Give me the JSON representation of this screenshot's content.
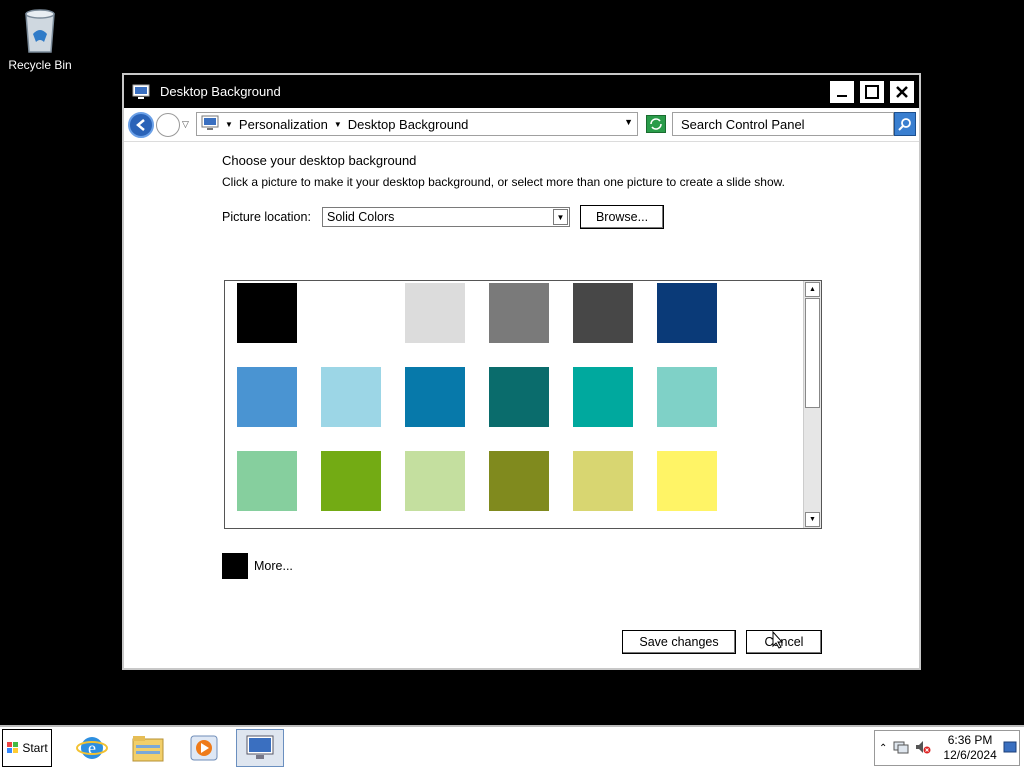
{
  "desktop": {
    "recycle_bin_label": "Recycle Bin"
  },
  "window": {
    "title": "Desktop Background",
    "breadcrumb": [
      "Personalization",
      "Desktop Background"
    ],
    "search_placeholder": "Search Control Panel",
    "heading": "Choose your desktop background",
    "description": "Click a picture to make it your desktop background, or select more than one picture to create a slide show.",
    "picture_location_label": "Picture location:",
    "picture_location_value": "Solid Colors",
    "browse_label": "Browse...",
    "more_label": "More...",
    "save_label": "Save changes",
    "cancel_label": "Cancel"
  },
  "colors": [
    [
      "#000000",
      "#FFFFFF",
      "#DCDCDC",
      "#7A7A7A",
      "#474747",
      "#0A3A78"
    ],
    [
      "#4A94D2",
      "#9CD6E6",
      "#0779AA",
      "#0A6C6C",
      "#00A99E",
      "#7FD1C7"
    ],
    [
      "#86CF9E",
      "#73AB14",
      "#C4DF9F",
      "#808A1E",
      "#D8D671",
      "#FFF466"
    ]
  ],
  "taskbar": {
    "start_label": "Start",
    "time": "6:36 PM",
    "date": "12/6/2024"
  }
}
